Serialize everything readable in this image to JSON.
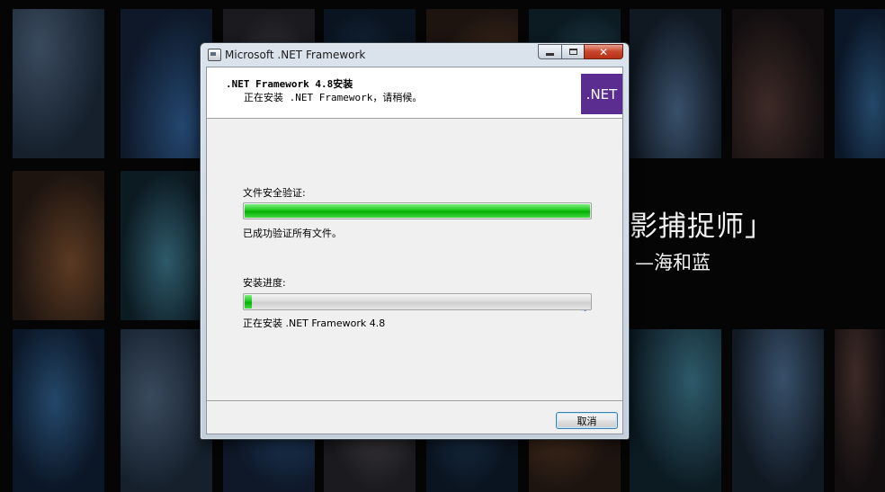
{
  "desktop": {
    "wallpaper_title": "影捕捉师」",
    "wallpaper_subtitle": "—海和蓝"
  },
  "window": {
    "title": "Microsoft .NET Framework",
    "close_glyph": "✕",
    "header_title": ".NET Framework 4.8安装",
    "header_subtitle": "正在安装 .NET Framework，请稍候。",
    "logo_text": ".NET",
    "logo_color": "#5c2d91"
  },
  "verification": {
    "label": "文件安全验证:",
    "progress_fraction": 1.0,
    "status": "已成功验证所有文件。"
  },
  "install": {
    "label": "安装进度:",
    "progress_fraction": 0.02,
    "status": "正在安装 .NET Framework 4.8"
  },
  "buttons": {
    "cancel": "取消"
  },
  "colors": {
    "progress_green": "#06b106",
    "accent_blue": "#3c7fb1"
  }
}
